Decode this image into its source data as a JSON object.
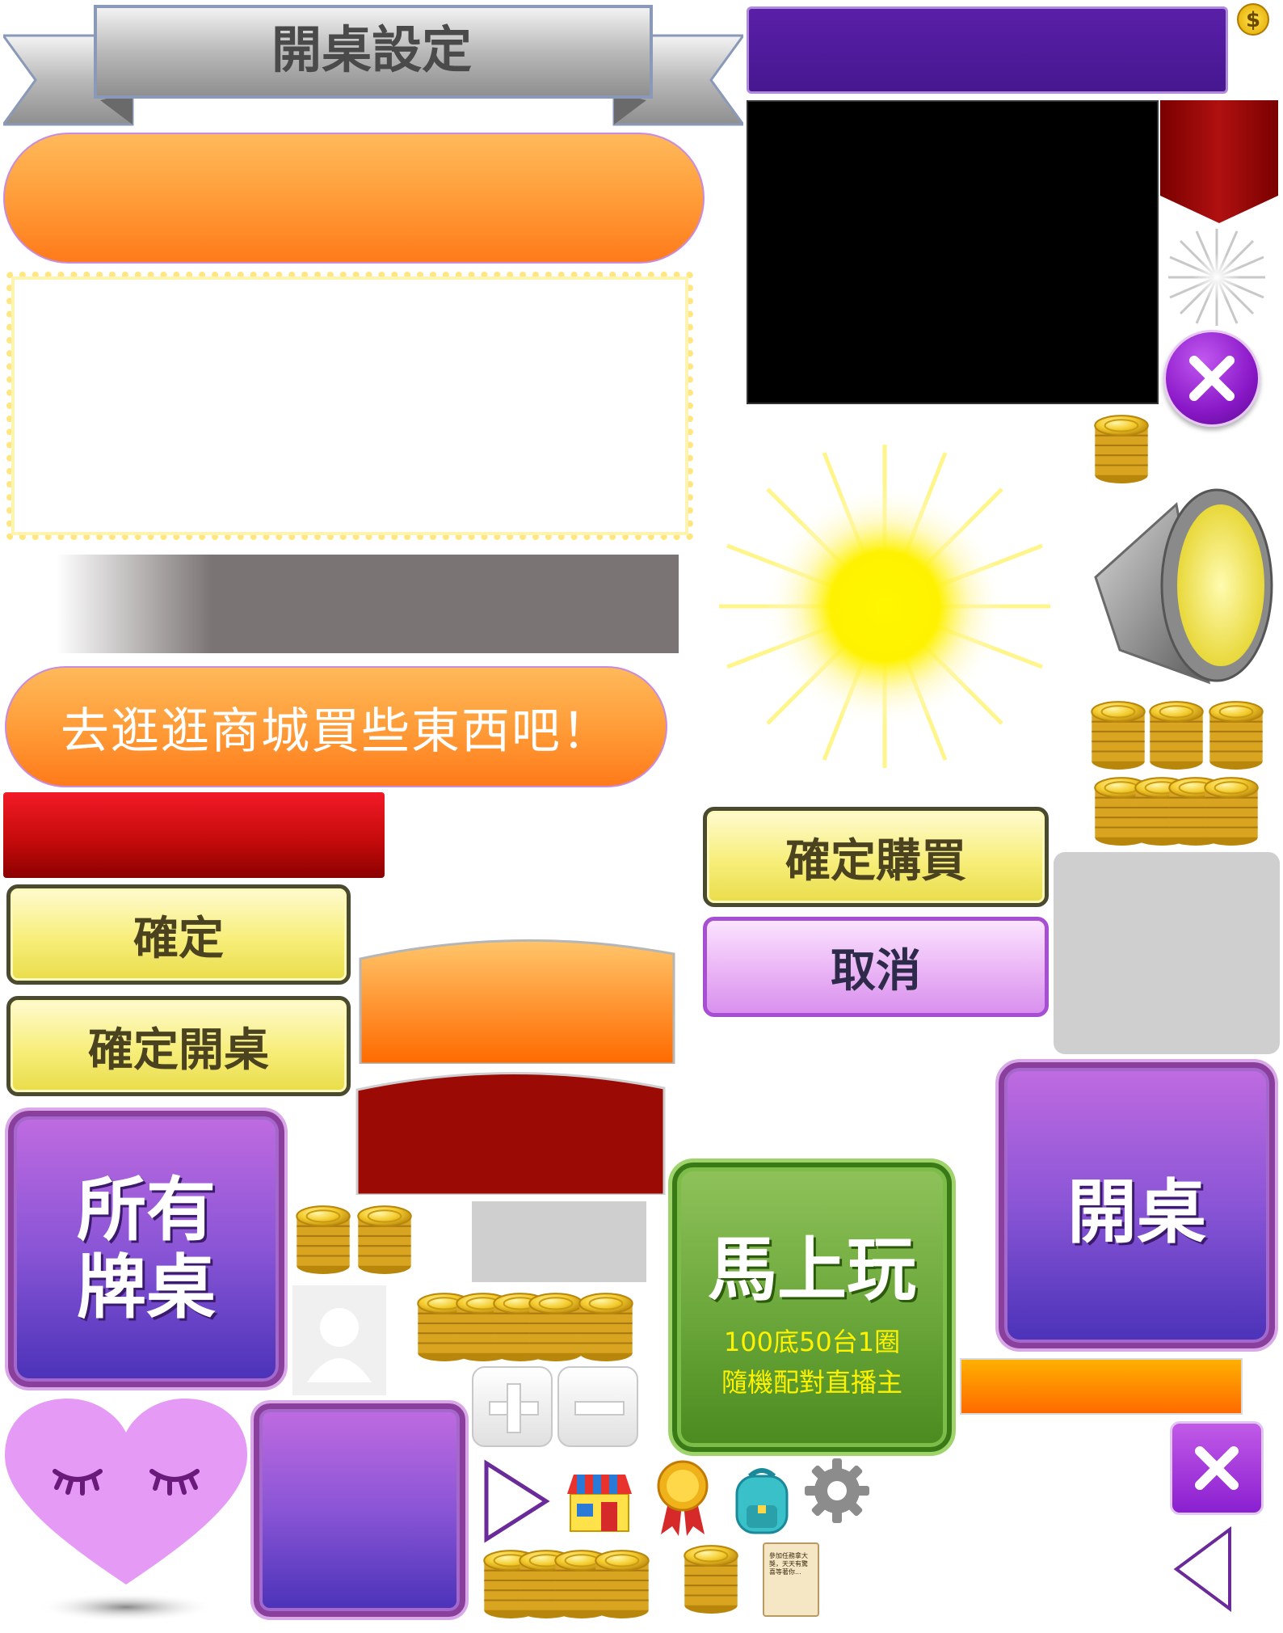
{
  "banner": {
    "title": "開桌設定"
  },
  "shop_prompt": {
    "label": "去逛逛商城買些東西吧！"
  },
  "buttons": {
    "confirm": "確定",
    "confirm_open": "確定開桌",
    "confirm_buy": "確定購買",
    "cancel": "取消",
    "all_tables_line1": "所有",
    "all_tables_line2": "牌桌",
    "open_table": "開桌",
    "play_now": "馬上玩",
    "play_now_sub1": "100底50台1圈",
    "play_now_sub2": "隨機配對直播主"
  },
  "scroll_note": "參加任務拿大獎，天天有驚喜等著你...",
  "currency_badge": "$",
  "icons": [
    "coin-icon",
    "dollar-badge-icon",
    "close-icon",
    "plus-icon",
    "minus-icon",
    "play-arrow-icon",
    "back-arrow-icon",
    "shop-icon",
    "medal-icon",
    "backpack-icon",
    "gear-icon",
    "scroll-icon",
    "avatar-icon",
    "sun-icon",
    "spotlight-icon",
    "heart-icon"
  ],
  "colors": {
    "purple": "#4a1a9a",
    "orange": "#ff8a24",
    "dark_red": "#9c0f0f",
    "gray": "#cfcfcf",
    "green": "#6aa63a"
  }
}
